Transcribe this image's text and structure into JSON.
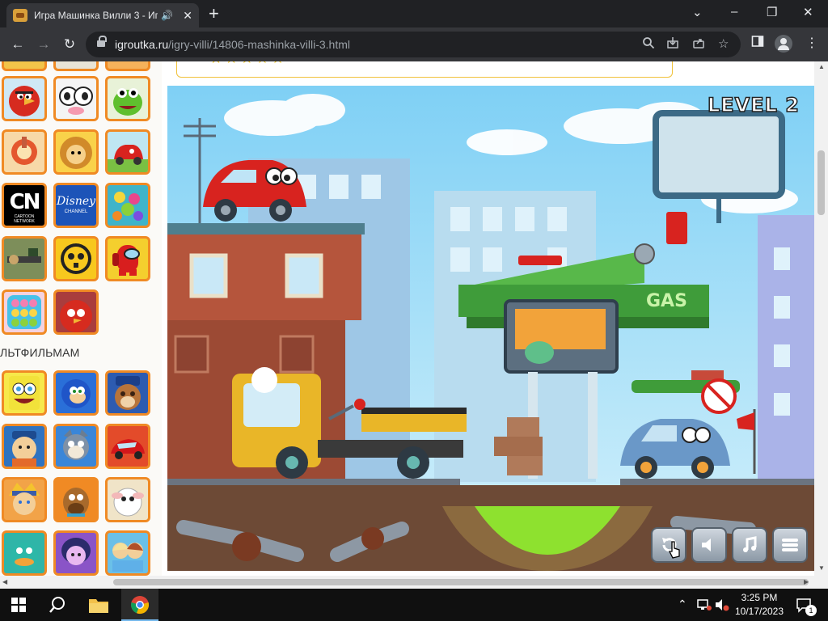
{
  "browser": {
    "tab_title": "Игра Машинка Вилли 3 - Иг",
    "new_tab_icon": "plus-icon",
    "url_domain": "igroutka.ru",
    "url_path": "/igry-villi/14806-mashinka-villi-3.html"
  },
  "sidebar": {
    "section_title": "ЛЬТФИЛЬМАМ",
    "thumb_cn_label": "CN",
    "thumb_cn_sub": "CARTOON NETWORK",
    "thumb_disney_label": "Disney",
    "thumb_disney_sub": "CHANNEL"
  },
  "page": {
    "rating_stars": "★★★★★"
  },
  "game": {
    "level_label": "LEVEL 2",
    "gas_label": "GAS"
  },
  "taskbar": {
    "time": "3:25 PM",
    "date": "10/17/2023",
    "notification_count": "1"
  },
  "colors": {
    "accent_orange": "#f08a24",
    "chrome_dark": "#202124",
    "chrome_toolbar": "#35363a",
    "taskbar": "#101010"
  }
}
